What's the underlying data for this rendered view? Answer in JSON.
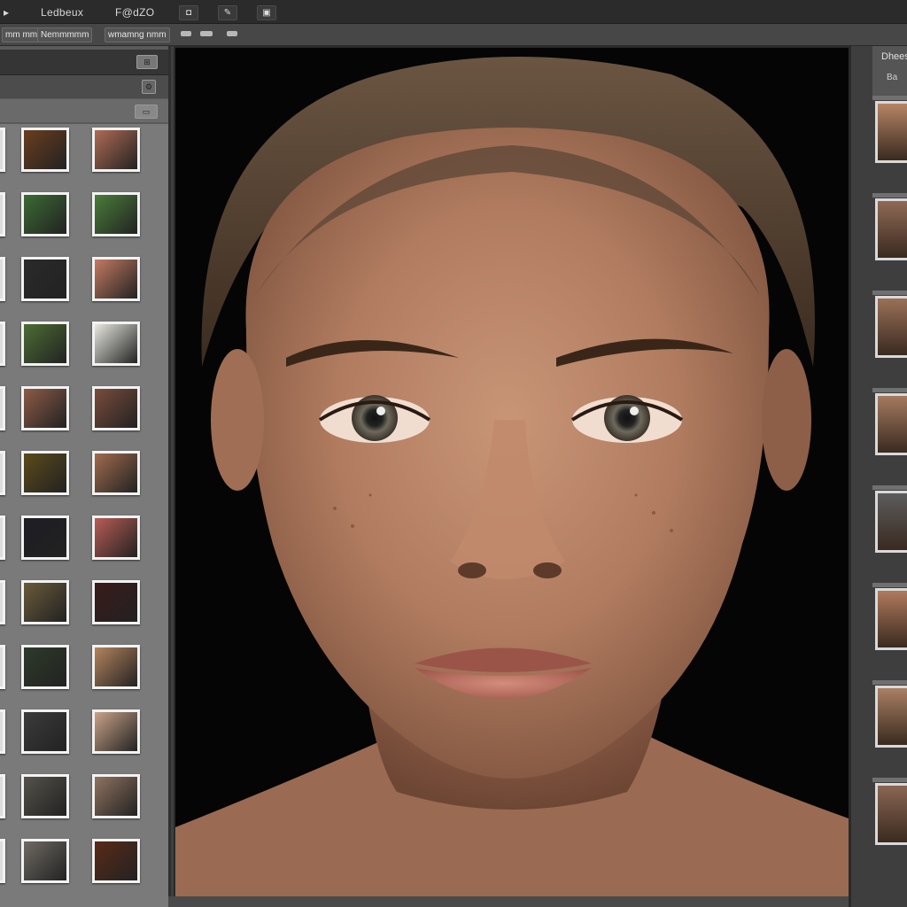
{
  "menu": {
    "items": [
      "Ledbeux",
      "F@dZO"
    ]
  },
  "toolbar": {
    "icons": [
      "camera-icon",
      "pen-icon",
      "gallery-icon"
    ]
  },
  "tabs": [
    "mm mm mm",
    "Nemmmmm",
    "wmamng nmm"
  ],
  "right_panel": {
    "title": "Dhees",
    "subtitle": "Ba"
  },
  "colors": {
    "panel_bg": "#5a5a5a",
    "canvas_bg": "#050505",
    "thumb_border": "#f2f2f2"
  },
  "left_thumbs": [
    {
      "col": 1,
      "row": 1,
      "color": "#6b3d1e",
      "name": "thumb-brown-texture"
    },
    {
      "col": 2,
      "row": 1,
      "color": "#b06b55",
      "name": "thumb-figure"
    },
    {
      "col": 1,
      "row": 2,
      "color": "#3c6a34",
      "name": "thumb-green-leaf"
    },
    {
      "col": 2,
      "row": 2,
      "color": "#4a7d3a",
      "name": "thumb-green-leaf-2"
    },
    {
      "col": 1,
      "row": 3,
      "color": "#2a2a2a",
      "name": "thumb-dark-figure"
    },
    {
      "col": 2,
      "row": 3,
      "color": "#c47a62",
      "name": "thumb-skin-round"
    },
    {
      "col": 1,
      "row": 4,
      "color": "#4c6d34",
      "name": "thumb-green"
    },
    {
      "col": 2,
      "row": 4,
      "color": "#e8e8e0",
      "name": "thumb-white"
    },
    {
      "col": 1,
      "row": 5,
      "color": "#8d5b47",
      "name": "thumb-arm"
    },
    {
      "col": 2,
      "row": 5,
      "color": "#7a4c3c",
      "name": "thumb-hand"
    },
    {
      "col": 1,
      "row": 6,
      "color": "#5b4a1a",
      "name": "thumb-olive"
    },
    {
      "col": 2,
      "row": 6,
      "color": "#a06b4e",
      "name": "thumb-skin-2"
    },
    {
      "col": 1,
      "row": 7,
      "color": "#1d1d24",
      "name": "thumb-figure-dark"
    },
    {
      "col": 2,
      "row": 7,
      "color": "#b85c55",
      "name": "thumb-face-red"
    },
    {
      "col": 1,
      "row": 8,
      "color": "#6a5a3a",
      "name": "thumb-brown"
    },
    {
      "col": 2,
      "row": 8,
      "color": "#3a1a1a",
      "name": "thumb-dark-red"
    },
    {
      "col": 1,
      "row": 9,
      "color": "#2e3a2a",
      "name": "thumb-dark-green"
    },
    {
      "col": 2,
      "row": 9,
      "color": "#b4835e",
      "name": "thumb-tan"
    },
    {
      "col": 1,
      "row": 10,
      "color": "#3b3b3b",
      "name": "thumb-diagonal"
    },
    {
      "col": 2,
      "row": 10,
      "color": "#c9a288",
      "name": "thumb-portrait"
    },
    {
      "col": 1,
      "row": 11,
      "color": "#55524a",
      "name": "thumb-grey-stone"
    },
    {
      "col": 2,
      "row": 11,
      "color": "#8f7360",
      "name": "thumb-group"
    },
    {
      "col": 1,
      "row": 12,
      "color": "#6f6a62",
      "name": "thumb-fur"
    },
    {
      "col": 2,
      "row": 12,
      "color": "#5a2a18",
      "name": "thumb-dark-portrait"
    }
  ],
  "right_thumbs": [
    {
      "color": "#b58565",
      "name": "right-thumb-1"
    },
    {
      "color": "#8f6a55",
      "name": "right-thumb-2"
    },
    {
      "color": "#9a7058",
      "name": "right-thumb-3"
    },
    {
      "color": "#a57a60",
      "name": "right-thumb-4"
    },
    {
      "color": "#5c5c5c",
      "name": "right-thumb-5"
    },
    {
      "color": "#b07a5d",
      "name": "right-thumb-6"
    },
    {
      "color": "#a98063",
      "name": "right-thumb-7"
    },
    {
      "color": "#8a6652",
      "name": "right-thumb-8"
    }
  ]
}
